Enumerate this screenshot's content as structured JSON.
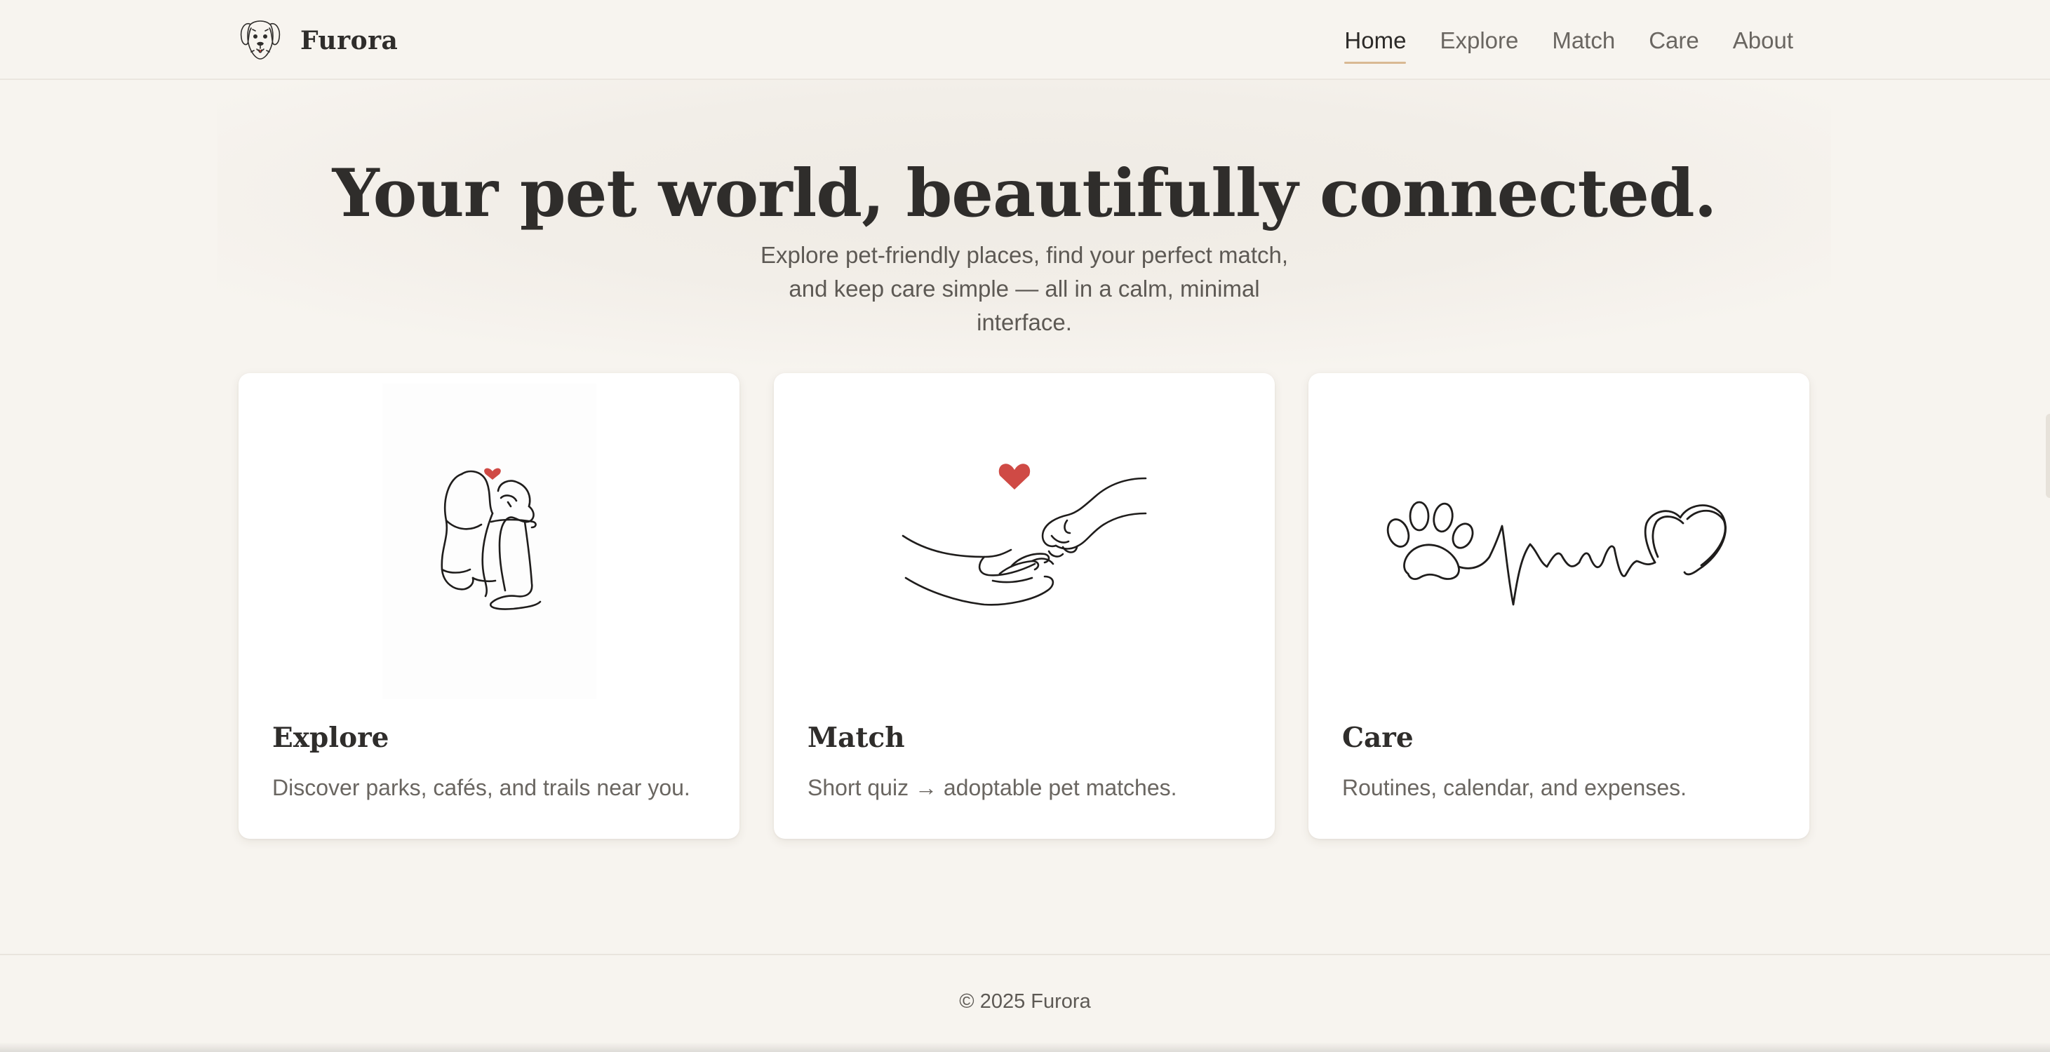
{
  "app": {
    "brand": "Furora",
    "logo_icon": "dog-face-icon"
  },
  "nav": {
    "items": [
      {
        "label": "Home",
        "active": true
      },
      {
        "label": "Explore",
        "active": false
      },
      {
        "label": "Match",
        "active": false
      },
      {
        "label": "Care",
        "active": false
      },
      {
        "label": "About",
        "active": false
      }
    ]
  },
  "hero": {
    "title": "Your pet world, beautifully connected.",
    "subtitle": "Explore pet-friendly places, find your perfect match, and keep care simple — all in a calm, minimal interface."
  },
  "cards": [
    {
      "title": "Explore",
      "description": "Discover parks, cafés, and trails near you.",
      "illustration": "person-hugging-dog-icon"
    },
    {
      "title": "Match",
      "description": "Short quiz → adoptable pet matches.",
      "illustration": "hand-and-paw-heart-icon"
    },
    {
      "title": "Care",
      "description": "Routines, calendar, and expenses.",
      "illustration": "paw-heartbeat-heart-icon"
    }
  ],
  "footer": {
    "copyright": "© 2025 Furora"
  },
  "colors": {
    "background": "#f7f4ef",
    "text": "#2f2d2b",
    "muted_text": "#6a6661",
    "nav_underline": "#d9b993",
    "heart_accent": "#cf4a45",
    "card_bg": "#ffffff"
  }
}
